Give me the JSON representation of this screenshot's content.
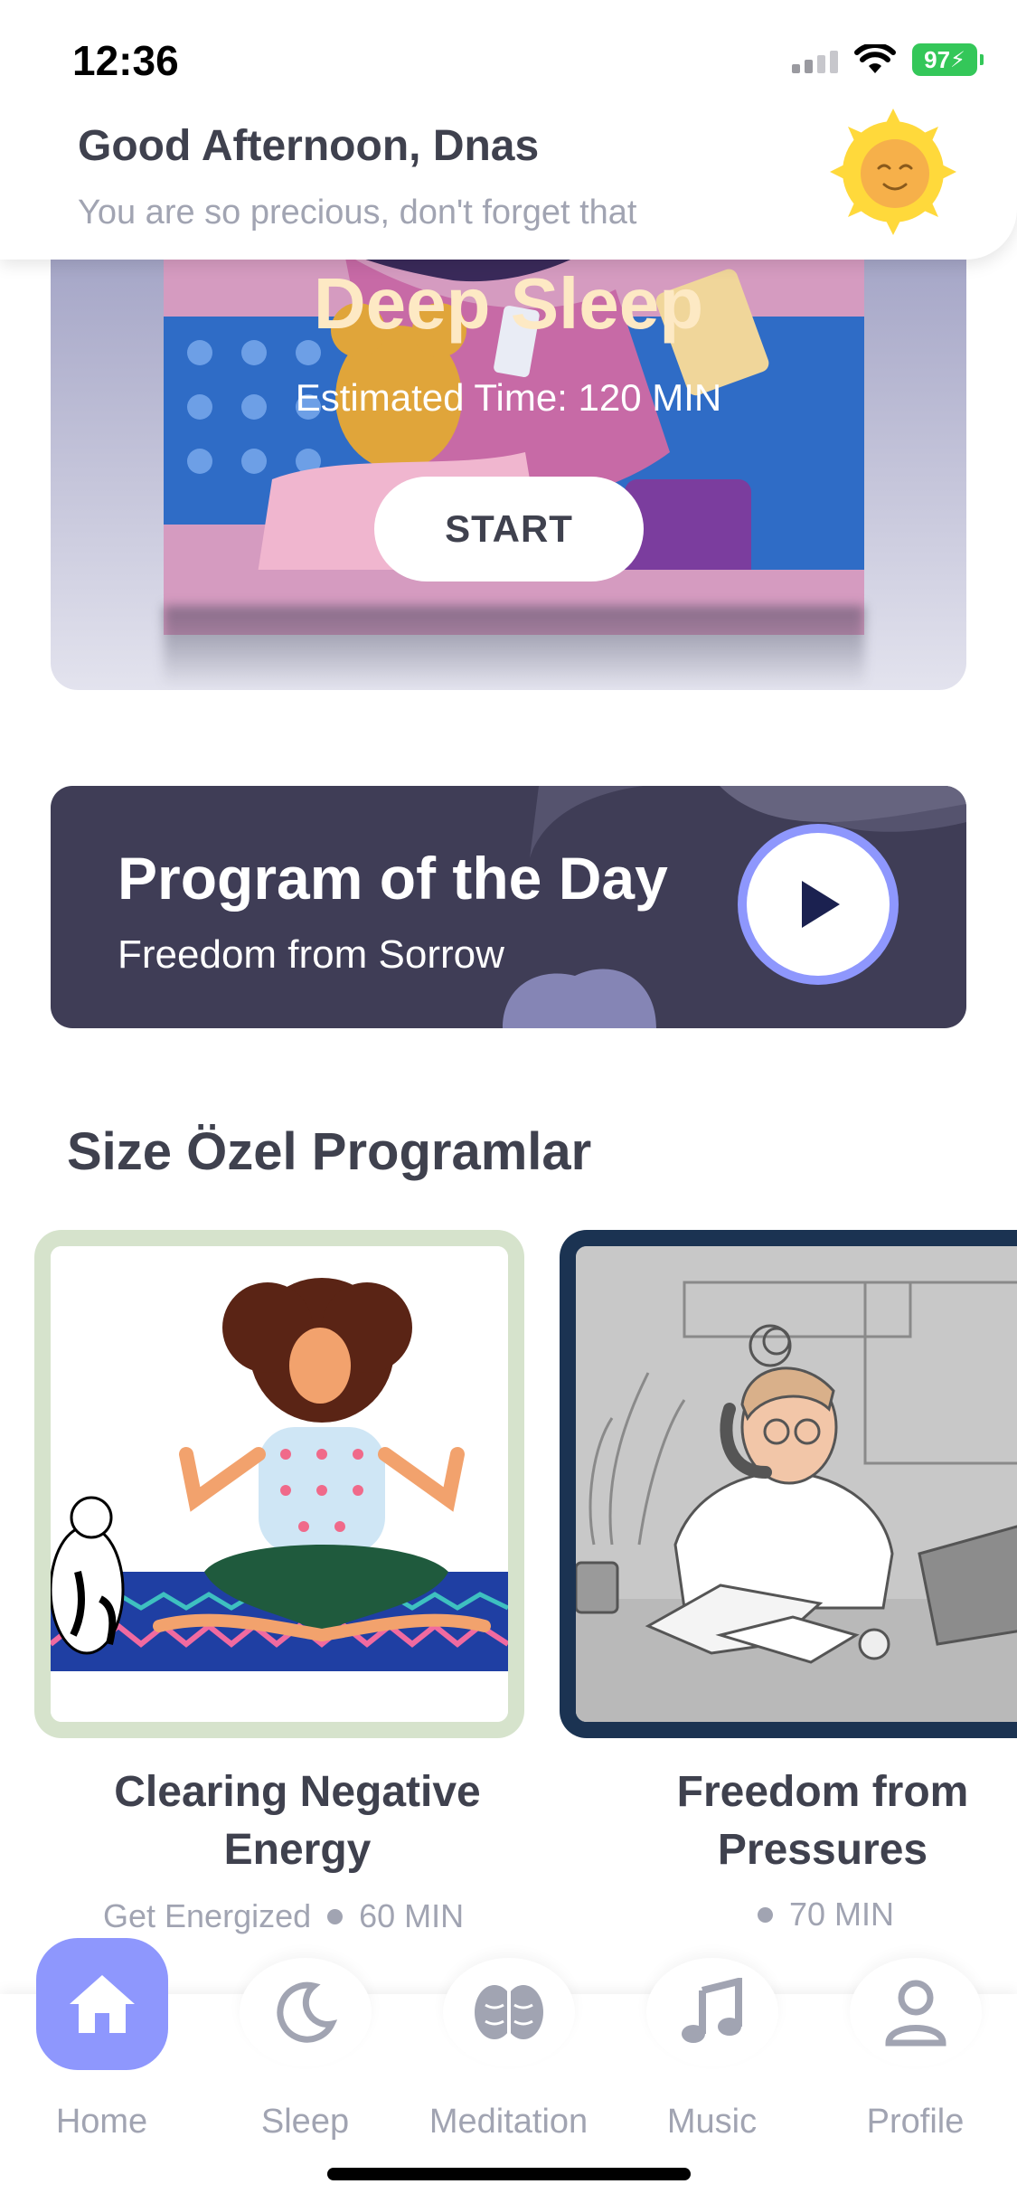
{
  "status_bar": {
    "time": "12:36",
    "battery": "97"
  },
  "header": {
    "greeting": "Good Afternoon, Dnas",
    "subtitle": "You are so precious, don't forget that"
  },
  "featured": {
    "title": "Deep Sleep",
    "estimated": "Estimated Time: 120 MIN",
    "start_label": "START"
  },
  "program_of_day": {
    "title": "Program of the Day",
    "subtitle": "Freedom from Sorrow"
  },
  "section": {
    "title": "Size Özel Programlar"
  },
  "programs": [
    {
      "title_line1": "Clearing Negative",
      "title_line2": "Energy",
      "category": "Get Energized",
      "duration": "60 MIN"
    },
    {
      "title_line1": "Freedom from",
      "title_line2": "Pressures",
      "category": "",
      "duration": "70 MIN"
    }
  ],
  "nav": [
    {
      "label": "Home",
      "icon": "home-icon",
      "active": true
    },
    {
      "label": "Sleep",
      "icon": "moon-icon",
      "active": false
    },
    {
      "label": "Meditation",
      "icon": "brain-icon",
      "active": false
    },
    {
      "label": "Music",
      "icon": "music-note-icon",
      "active": false
    },
    {
      "label": "Profile",
      "icon": "profile-icon",
      "active": false
    }
  ],
  "colors": {
    "accent": "#8e97fd",
    "dark_card": "#3f3d56",
    "text": "#3f414e",
    "muted": "#a1a4b2",
    "featured_title": "#fde9c4"
  }
}
